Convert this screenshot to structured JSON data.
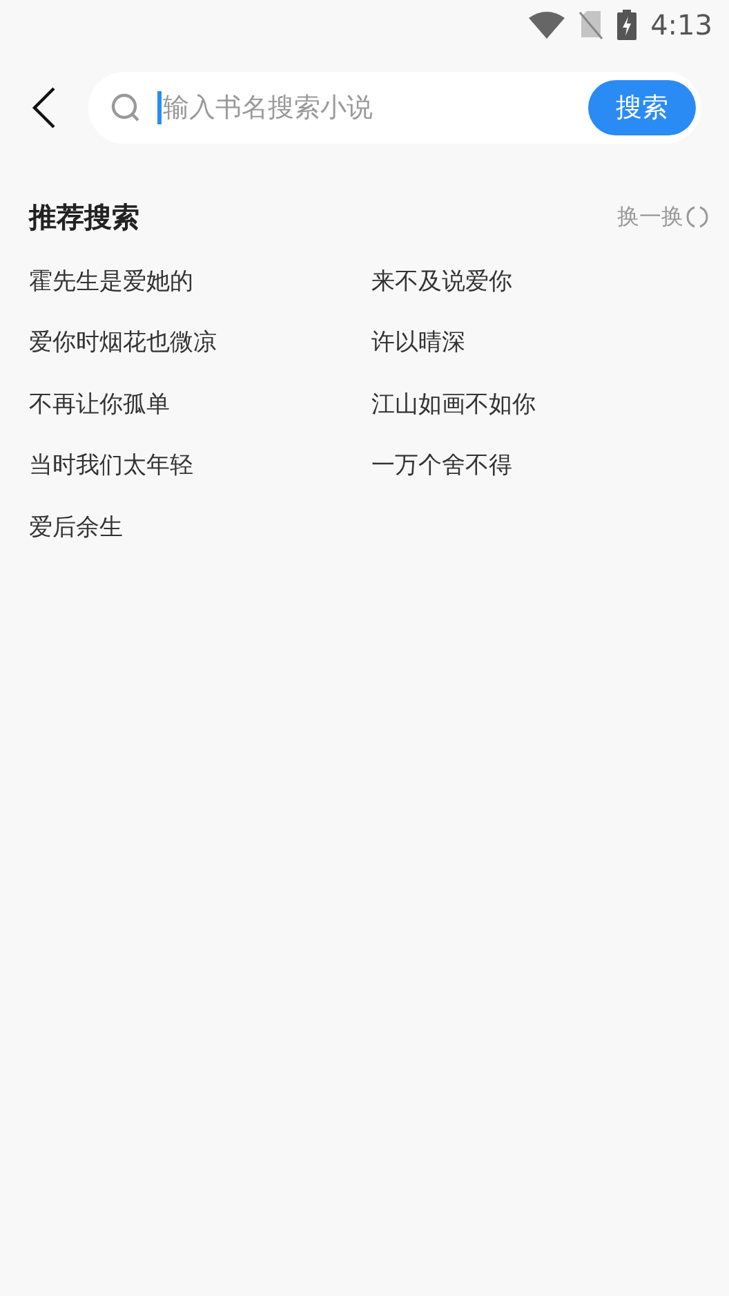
{
  "status_bar": {
    "time": "4:13"
  },
  "search": {
    "placeholder": "输入书名搜索小说",
    "button": "搜索"
  },
  "recommend": {
    "title": "推荐搜索",
    "refresh": "换一换",
    "items": [
      "霍先生是爱她的",
      "来不及说爱你",
      "爱你时烟花也微凉",
      "许以晴深",
      "不再让你孤单",
      "江山如画不如你",
      "当时我们太年轻",
      "一万个舍不得",
      "爱后余生"
    ]
  }
}
